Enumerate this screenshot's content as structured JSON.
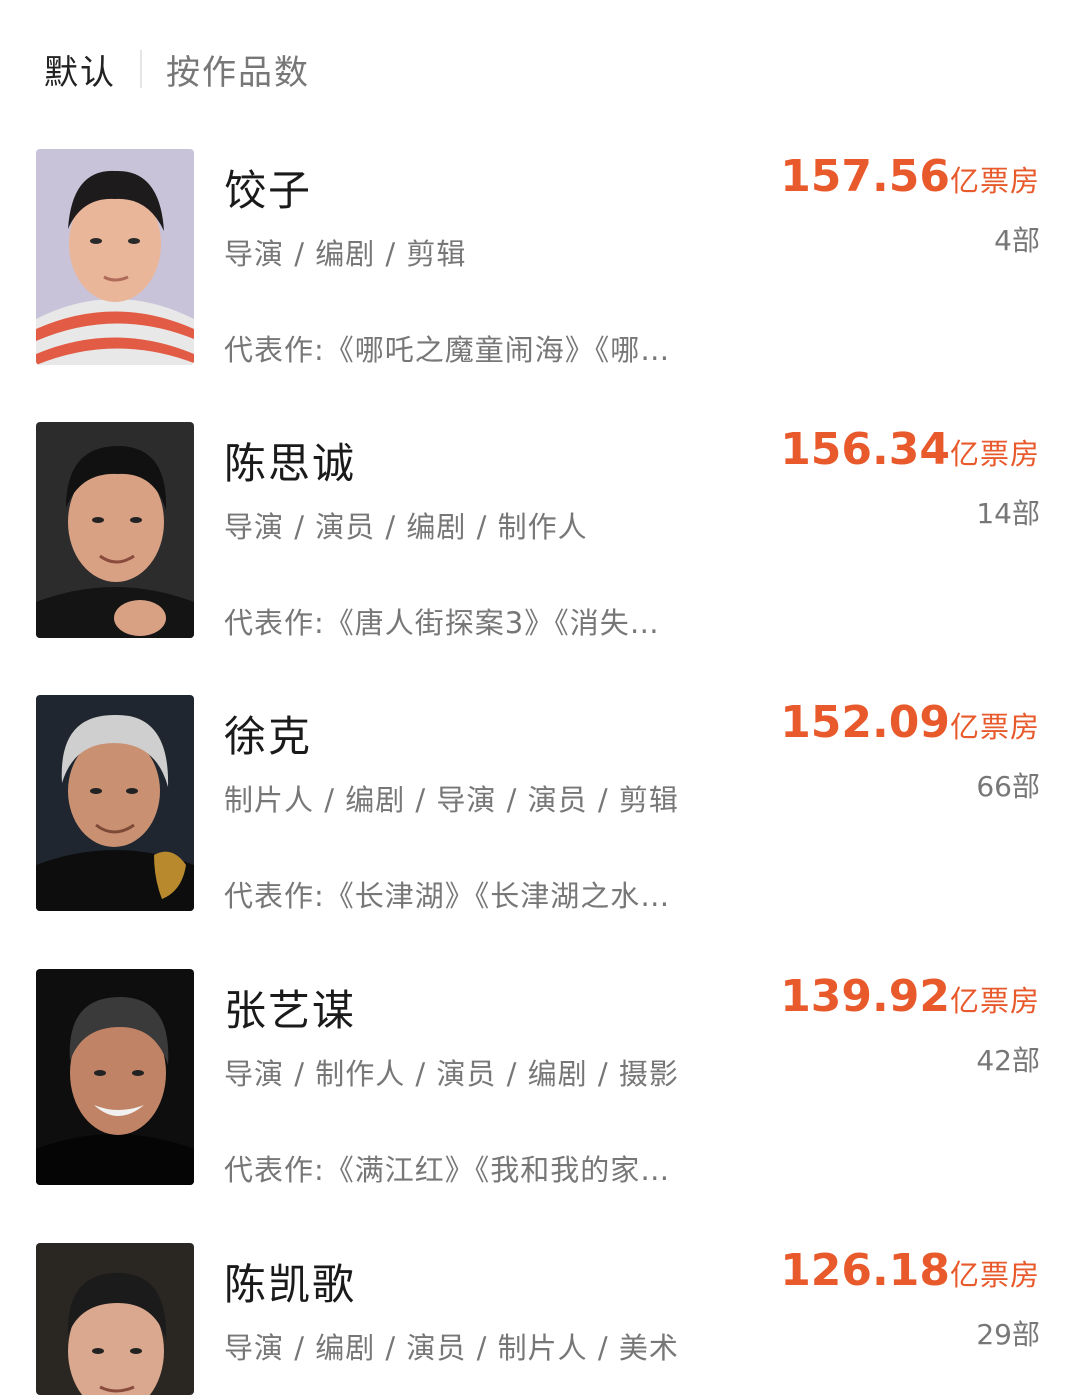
{
  "sort_tabs": [
    {
      "label": "默认"
    },
    {
      "label": "按作品数"
    }
  ],
  "items": [
    {
      "name": "饺子",
      "roles": "导演 / 编剧 / 剪辑",
      "works": "代表作:《哪吒之魔童闹海》《哪…",
      "box_office_value": "157.56",
      "box_office_unit": "亿票房",
      "count": "4部",
      "avatar": "avatar-jiaozi"
    },
    {
      "name": "陈思诚",
      "roles": "导演 / 演员 / 编剧 / 制作人",
      "works": "代表作:《唐人街探案3》《消失…",
      "box_office_value": "156.34",
      "box_office_unit": "亿票房",
      "count": "14部",
      "avatar": "avatar-chensicheng"
    },
    {
      "name": "徐克",
      "roles": "制片人 / 编剧 / 导演 / 演员 / 剪辑",
      "works": "代表作:《长津湖》《长津湖之水…",
      "box_office_value": "152.09",
      "box_office_unit": "亿票房",
      "count": "66部",
      "avatar": "avatar-xuke"
    },
    {
      "name": "张艺谋",
      "roles": "导演 / 制作人 / 演员 / 编剧 / 摄影",
      "works": "代表作:《满江红》《我和我的家…",
      "box_office_value": "139.92",
      "box_office_unit": "亿票房",
      "count": "42部",
      "avatar": "avatar-zhangyimou"
    },
    {
      "name": "陈凯歌",
      "roles": "导演 / 编剧 / 演员 / 制片人 / 美术",
      "works": "",
      "box_office_value": "126.18",
      "box_office_unit": "亿票房",
      "count": "29部",
      "avatar": "avatar-chenkaige"
    }
  ],
  "colors": {
    "accent": "#e8592c",
    "secondary_text": "#777777",
    "primary_text": "#1a1a1a"
  }
}
